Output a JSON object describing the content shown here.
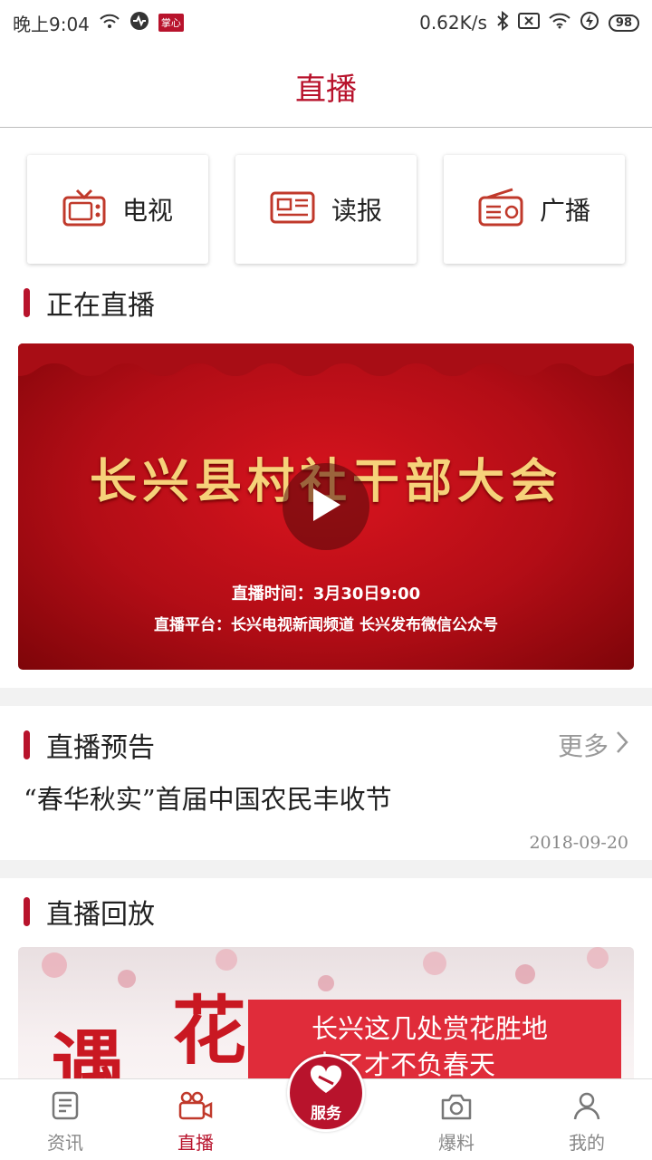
{
  "status_bar": {
    "time": "晚上9:04",
    "app_badge": "掌心",
    "speed": "0.62K/s",
    "battery": "98"
  },
  "header": {
    "title": "直播"
  },
  "categories": [
    {
      "label": "电视",
      "icon": "tv-icon"
    },
    {
      "label": "读报",
      "icon": "newspaper-icon"
    },
    {
      "label": "广播",
      "icon": "radio-icon"
    }
  ],
  "now_live": {
    "section_title": "正在直播",
    "banner_title": "长兴县村社干部大会",
    "time_text": "直播时间：3月30日9:00",
    "platform_text": "直播平台：长兴电视新闻频道 长兴发布微信公众号"
  },
  "preview": {
    "section_title": "直播预告",
    "more_label": "更多",
    "items": [
      {
        "title": "“春华秋实”首届中国农民丰收节",
        "date": "2018-09-20"
      }
    ]
  },
  "replay": {
    "section_title": "直播回放",
    "image_chars": [
      "遇",
      "花"
    ],
    "image_text_line1": "长兴这几处赏花胜地",
    "image_text_line2": "去了才不负春天"
  },
  "tabbar": {
    "items": [
      {
        "label": "资讯",
        "icon": "news-icon",
        "active": false
      },
      {
        "label": "直播",
        "icon": "video-camera-icon",
        "active": true
      },
      {
        "label": "服务",
        "icon": "heart-icon",
        "active": false
      },
      {
        "label": "爆料",
        "icon": "camera-icon",
        "active": false
      },
      {
        "label": "我的",
        "icon": "user-icon",
        "active": false
      }
    ]
  },
  "colors": {
    "accent": "#b8132c",
    "banner_red": "#c9151f"
  }
}
